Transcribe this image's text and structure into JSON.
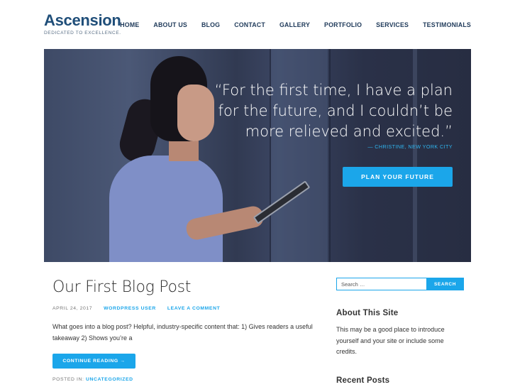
{
  "site": {
    "title": "Ascension",
    "tagline": "DEDICATED TO EXCELLENCE."
  },
  "nav": {
    "items": [
      {
        "label": "HOME"
      },
      {
        "label": "ABOUT US"
      },
      {
        "label": "BLOG"
      },
      {
        "label": "CONTACT"
      },
      {
        "label": "GALLERY"
      },
      {
        "label": "PORTFOLIO"
      },
      {
        "label": "SERVICES"
      },
      {
        "label": "TESTIMONIALS"
      }
    ]
  },
  "hero": {
    "quote_line1": "“For the first time, I have a plan",
    "quote_line2": "for the future, and I couldn’t be",
    "quote_line3": "more relieved and excited.”",
    "author": "— CHRISTINE, NEW YORK CITY",
    "cta_label": "PLAN YOUR FUTURE"
  },
  "post": {
    "title": "Our First Blog Post",
    "date": "APRIL 24, 2017",
    "author": "WORDPRESS USER",
    "comment_link": "LEAVE A COMMENT",
    "excerpt": "What goes into a blog post? Helpful, industry-specific content that: 1) Gives readers a useful takeaway 2) Shows you’re a",
    "read_more": "CONTINUE READING →",
    "category_label": "POSTED IN:",
    "category": "UNCATEGORIZED"
  },
  "sidebar": {
    "search_placeholder": "Search …",
    "search_button": "SEARCH",
    "about_title": "About This Site",
    "about_text": "This may be a good place to introduce yourself and your site or include some credits.",
    "recent_title": "Recent Posts"
  },
  "colors": {
    "brand": "#1f4e79",
    "accent": "#1ba6ea"
  }
}
